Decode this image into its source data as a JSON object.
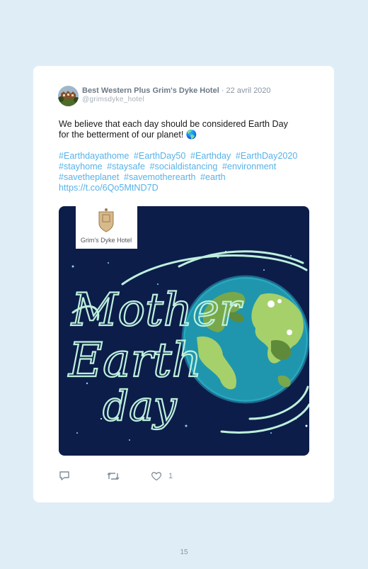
{
  "tweet": {
    "author_name": "Best Western Plus Grim's Dyke Hotel",
    "date": "· 22 avril 2020",
    "handle": "@grimsdyke_hotel",
    "text_line1": "We believe that each day should be considered Earth Day",
    "text_line2": "for the betterment of our planet! 🌎",
    "hashtags": [
      "#Earthdayathome",
      "#EarthDay50",
      "#Earthday",
      "#EarthDay2020",
      "#stayhome",
      "#staysafe",
      "#socialdistancing",
      "#environment",
      "#savetheplanet",
      "#savemotherearth",
      "#earth"
    ],
    "link": "https://t.co/6Qo5MtND7D",
    "image": {
      "logo_text": "Grim's Dyke Hotel",
      "title_line1": "Mother",
      "title_line2": "Earth",
      "title_line3": "day"
    },
    "actions": {
      "reply_icon": "reply-icon",
      "retweet_icon": "retweet-icon",
      "like_icon": "heart-icon",
      "like_count": "1"
    }
  },
  "page": {
    "number": "15"
  },
  "colors": {
    "background": "#dfeef6",
    "card": "#ffffff",
    "link": "#58b2e8",
    "image_bg": "#0d1d4a",
    "lettering": "#bdf0dc"
  }
}
